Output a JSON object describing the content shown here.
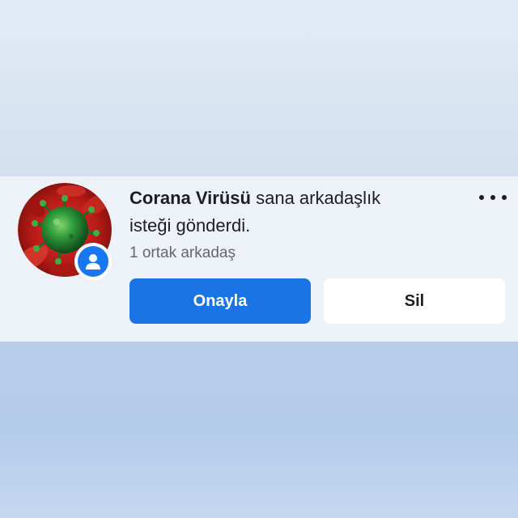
{
  "notification": {
    "sender_name": "Corana Virüsü",
    "message_rest_line1": " sana arkadaşlık",
    "message_line2": "isteği gönderdi.",
    "mutual_friends": "1 ortak arkadaş",
    "avatar_icon": "virus-image",
    "badge_icon": "friend-request-person-icon",
    "more_icon": "more-options-icon"
  },
  "actions": {
    "confirm_label": "Onayla",
    "delete_label": "Sil"
  },
  "colors": {
    "confirm_button": "#1b74e4",
    "delete_button": "#ffffff",
    "badge": "#1877f2",
    "card_background": "#edf2f8"
  }
}
